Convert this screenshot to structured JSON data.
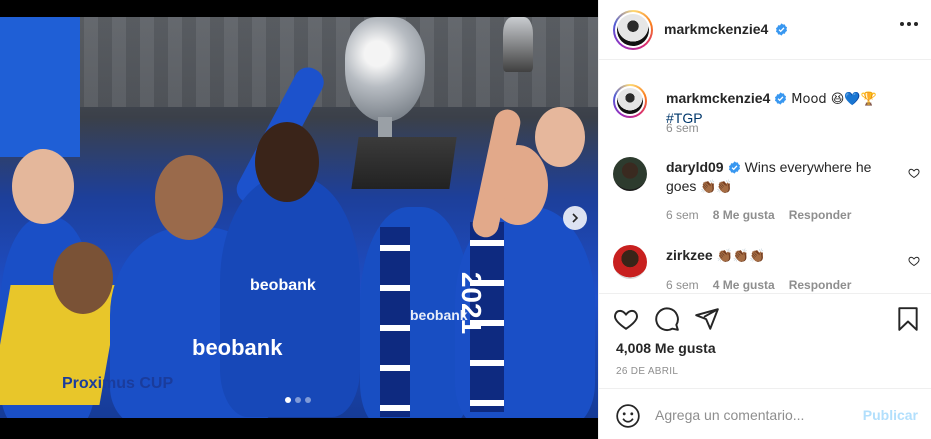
{
  "post": {
    "carousel": {
      "slide_count": 3,
      "active_slide": 1
    },
    "sponsor_texts": [
      "beobank",
      "beobank",
      "beobank",
      "Proximus CUP",
      "2021"
    ]
  },
  "header": {
    "username": "markmckenzie4",
    "verified": true,
    "more_icon": "more-horizontal-icon"
  },
  "caption": {
    "username": "markmckenzie4",
    "text": "Mood 😆💙🏆",
    "hashtag": "#TGP",
    "time": "6 sem"
  },
  "comments": [
    {
      "username": "daryld09",
      "verified": true,
      "text": "Wins everywhere he goes",
      "emoji": "👏🏾👏🏾",
      "time": "6 sem",
      "likes": "8 Me gusta",
      "reply": "Responder"
    },
    {
      "username": "zirkzee",
      "verified": false,
      "text": "",
      "emoji": "👏🏾👏🏾👏🏾",
      "time": "6 sem",
      "likes": "4 Me gusta",
      "reply": "Responder"
    }
  ],
  "actions": {
    "like_icon": "heart-icon",
    "comment_icon": "comment-icon",
    "share_icon": "paper-plane-icon",
    "save_icon": "bookmark-icon"
  },
  "likes_text": "4,008 Me gusta",
  "date_text": "26 DE ABRIL",
  "add_comment": {
    "placeholder": "Agrega un comentario...",
    "publish_label": "Publicar"
  },
  "colors": {
    "verified_blue": "#3897f0",
    "link_blue": "#00376b",
    "publish_disabled": "#b2dffc",
    "muted_text": "#8e8e8e"
  }
}
